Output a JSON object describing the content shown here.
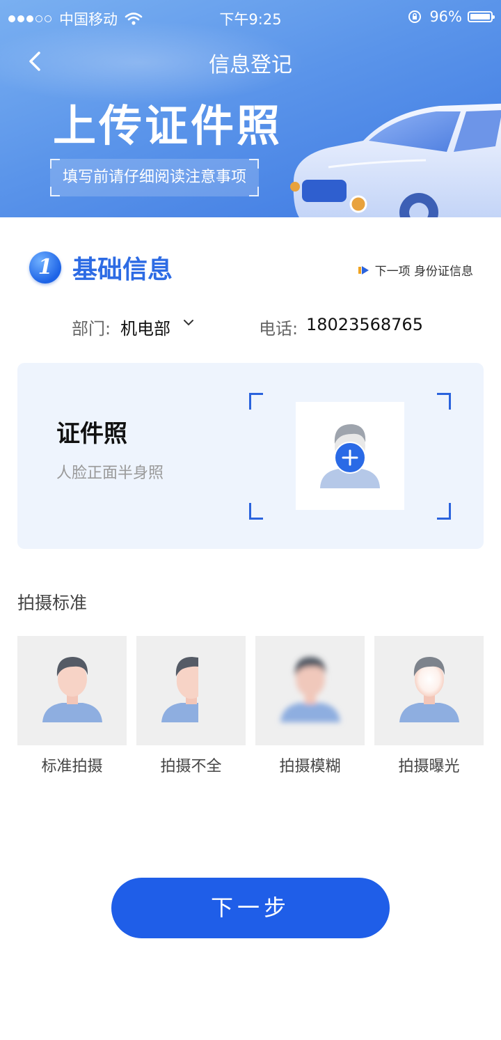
{
  "status_bar": {
    "carrier": "中国移动",
    "time": "下午9:25",
    "battery": "96%"
  },
  "nav": {
    "title": "信息登记"
  },
  "hero": {
    "title": "上传证件照",
    "subtitle": "填写前请仔细阅读注意事项"
  },
  "section": {
    "number": "1",
    "title": "基础信息",
    "next_hint": "下一项 身份证信息"
  },
  "info": {
    "dept_label": "部门:",
    "dept_value": "机电部",
    "phone_label": "电话:",
    "phone_value": "18023568765"
  },
  "photo_card": {
    "title": "证件照",
    "subtitle": "人脸正面半身照"
  },
  "standards": {
    "title": "拍摄标准",
    "items": [
      {
        "label": "标准拍摄"
      },
      {
        "label": "拍摄不全"
      },
      {
        "label": "拍摄模糊"
      },
      {
        "label": "拍摄曝光"
      }
    ]
  },
  "next_button": {
    "label": "下一步"
  },
  "colors": {
    "primary": "#1f5ee8",
    "accent_text": "#2d6be4",
    "card_bg": "#eef4fd"
  }
}
